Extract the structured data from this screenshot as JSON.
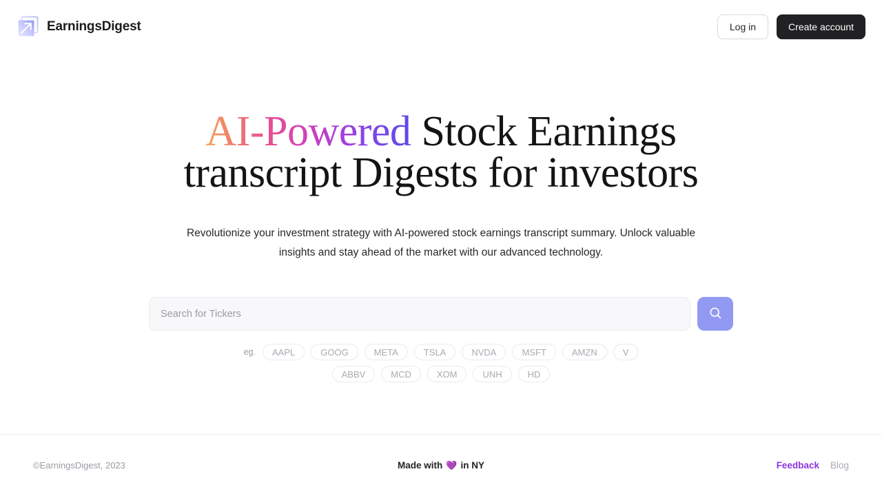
{
  "header": {
    "brand_name": "EarningsDigest",
    "logo_icon": "arrow-up-right-square-logo",
    "login_label": "Log in",
    "create_account_label": "Create account",
    "colors": {
      "create_account_bg": "#212124",
      "login_border": "#d9d9e0"
    }
  },
  "hero": {
    "title_gradient_part": "AI-Powered",
    "title_rest": " Stock Earnings transcript Digests for investors",
    "subtitle": "Revolutionize your investment strategy with AI-powered stock earnings transcript summary. Unlock valuable insights and stay ahead of the market with our advanced technology.",
    "gradient_colors": [
      "#f3a055",
      "#e8518f",
      "#d441b8",
      "#a93ddd",
      "#5b4ce8"
    ]
  },
  "search": {
    "placeholder": "Search for Tickers",
    "value": "",
    "button_icon": "search-icon",
    "button_color": "#9299f3"
  },
  "examples": {
    "label": "eg.",
    "tickers": [
      "AAPL",
      "GOOG",
      "META",
      "TSLA",
      "NVDA",
      "MSFT",
      "AMZN",
      "V",
      "ABBV",
      "MCD",
      "XOM",
      "UNH",
      "HD"
    ]
  },
  "footer": {
    "copyright": "©EarningsDigest, 2023",
    "made_with_prefix": "Made with",
    "heart_icon": "purple-heart-icon",
    "made_with_suffix": "in NY",
    "feedback_label": "Feedback",
    "blog_label": "Blog",
    "accent_color": "#8b34e0"
  }
}
